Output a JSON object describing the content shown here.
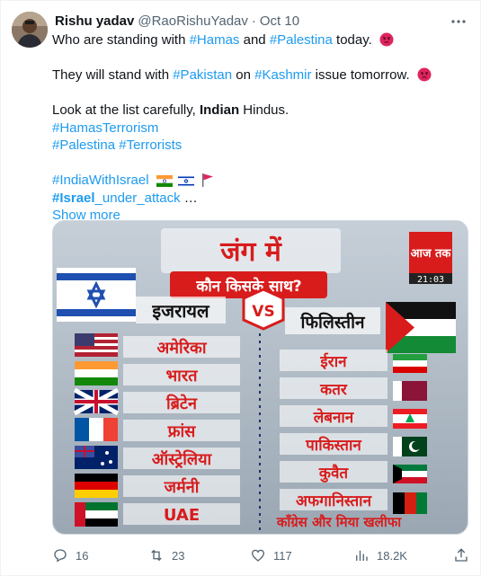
{
  "tweet": {
    "author_name": "Rishu yadav",
    "handle": "@RaoRishuYadav",
    "separator": "·",
    "date": "Oct 10",
    "lines": {
      "l1_pre": "Who are standing with ",
      "l1_tag1": "#Hamas",
      "l1_mid": " and ",
      "l1_tag2": "#Palestina",
      "l1_post": " today.",
      "l2_pre": "They will stand with ",
      "l2_tag1": "#Pakistan",
      "l2_mid": " on ",
      "l2_tag2": "#Kashmir",
      "l2_post": " issue tomorrow.",
      "l3_pre": "Look at the list carefully, ",
      "l3_bold": "Indian",
      "l3_post": " Hindus.",
      "l4_tag": "#HamasTerrorism",
      "l5_tag1": "#Palestina",
      "l5_sp": " ",
      "l5_tag2": "#Terrorists",
      "l6_tag": "#IndiaWithIsrael",
      "l7_tag_bold": "#Israel",
      "l7_tag_rest": "_under_attack",
      "l7_ellipsis": " …"
    },
    "show_more": "Show more"
  },
  "media": {
    "title_line1": "जंग में",
    "title_line2": "कौन किसके साथ?",
    "channel_logo": "आज तक",
    "clock": "21:03",
    "left_header": "इजरायल",
    "vs": "VS",
    "right_header": "फिलिस्तीन",
    "left_countries": [
      "अमेरिका",
      "भारत",
      "ब्रिटेन",
      "फ्रांस",
      "ऑस्ट्रेलिया",
      "जर्मनी",
      "UAE"
    ],
    "right_countries": [
      "ईरान",
      "कतर",
      "लेबनान",
      "पाकिस्तान",
      "कुवैत",
      "अफगानिस्तान"
    ],
    "bottom_right": "कॉंग्रेस और मिया खलीफा"
  },
  "actions": {
    "replies": "16",
    "reposts": "23",
    "likes": "117",
    "views": "18.2K"
  },
  "colors": {
    "link": "#1d9bf0",
    "secondary": "#536471",
    "media_red": "#d81c1c"
  }
}
